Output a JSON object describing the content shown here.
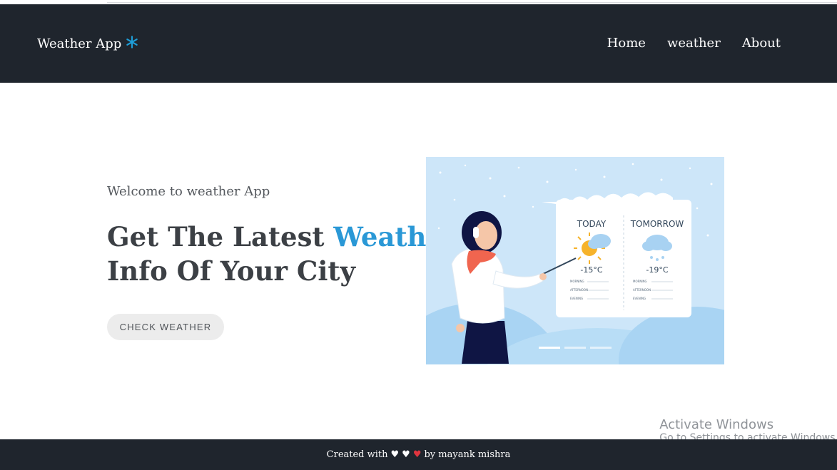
{
  "navbar": {
    "brand": "Weather App",
    "brand_icon": "snowflake-icon",
    "brand_icon_color": "#1e9ed8",
    "links": [
      {
        "label": "Home"
      },
      {
        "label": "weather"
      },
      {
        "label": "About"
      }
    ]
  },
  "hero": {
    "welcome": "Welcome to weather App",
    "headline_part1": "Get The Latest ",
    "headline_accent": "Weather",
    "headline_part2": "Info Of Your City",
    "cta_label": "CHECK WEATHER",
    "accent_color": "#2a98d6"
  },
  "illustration": {
    "today": {
      "label": "TODAY",
      "temp": "-15°C"
    },
    "tomorrow": {
      "label": "TOMORROW",
      "temp": "-19°C"
    },
    "rows": [
      "MORNING",
      "AFTERNOON",
      "EVENING"
    ]
  },
  "footer": {
    "created_with": "Created with",
    "by": "by mayank mishra",
    "hearts": [
      "white-heart-icon",
      "white-heart-icon",
      "red-heart-icon"
    ]
  },
  "system_watermark": {
    "line1": "Activate Windows",
    "line2": "Go to Settings to activate Windows."
  }
}
